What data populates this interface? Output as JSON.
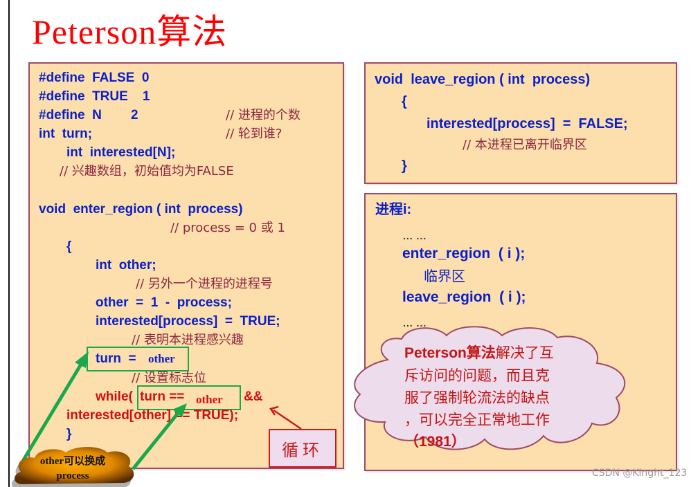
{
  "title": "Peterson算法",
  "left_panel": {
    "defines": [
      {
        "code": "#define  FALSE  0",
        "comment": ""
      },
      {
        "code": "#define  TRUE    1",
        "comment": ""
      },
      {
        "code": "#define  N        2",
        "comment": "// 进程的个数"
      },
      {
        "code": "int  turn;",
        "comment": "// 轮到谁?"
      }
    ],
    "interested_decl": "int  interested[N];",
    "interested_comment": "// 兴趣数组，初始值均为FALSE",
    "enter_sig": "void  enter_region ( int  process)",
    "enter_sig_comment": "// process = 0 或 1",
    "open_brace": "{",
    "int_other": "int  other;",
    "int_other_comment": "// 另外一个进程的进程号",
    "other_assign": "other  =  1  -  process;",
    "interested_assign": "interested[process]  =  TRUE;",
    "interested_assign_comment": "// 表明本进程感兴趣",
    "turn_assign_prefix": "turn  =",
    "turn_assign_value": "other",
    "turn_assign_comment": "// 设置标志位",
    "while_prefix": "while(",
    "while_turn": "turn ==",
    "while_value": "other",
    "while_and": "&&",
    "while_second": "interested[other] == TRUE);",
    "close_brace": "}"
  },
  "loop_label": "循环",
  "bubble_note": {
    "line1": "other可以换成",
    "line2": "process"
  },
  "leave_panel": {
    "sig": "void  leave_region ( int  process)",
    "open_brace": "{",
    "stmt": "interested[process]  =  FALSE;",
    "comment": "// 本进程已离开临界区",
    "close_brace": "}"
  },
  "process_panel": {
    "heading": "进程i:",
    "dots1": "... ...",
    "enter_call": "enter_region  ( i );",
    "critical": "临界区",
    "leave_call": "leave_region  ( i );",
    "dots2": "... ..."
  },
  "cloud_note": {
    "line1_bold": "Peterson算法",
    "line1_rest": "解决了互",
    "line2": "斥访问的问题，而且克",
    "line3": "服了强制轮流法的缺点",
    "line4": "，可以完全正常地工作",
    "line5": "（1981）"
  },
  "watermark": "CSDN @Kinght_123",
  "colors": {
    "title": "#ff0000",
    "panel_bg": "#fcdfad",
    "panel_border": "#9e4a64",
    "code_blue": "#0a1fc8",
    "comment": "#8b2840",
    "loop_red": "#d01010",
    "highlight_green": "#1aa84a",
    "cloud_fill": "#ecdcec"
  }
}
